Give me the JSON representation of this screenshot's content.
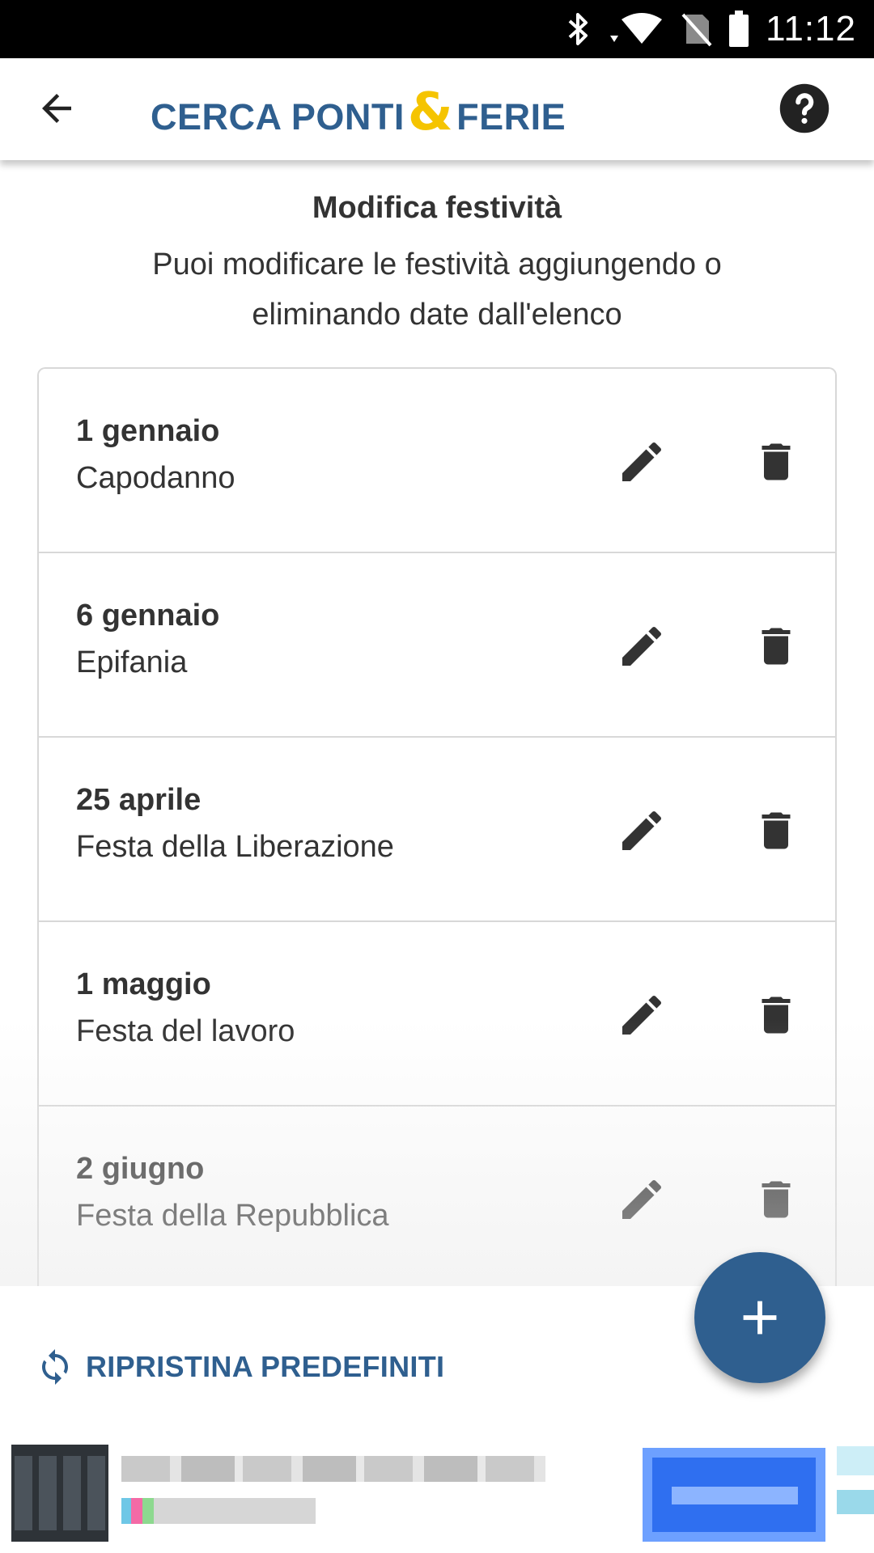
{
  "status_bar": {
    "time": "11:12",
    "icons": [
      "bluetooth-icon",
      "wifi-icon",
      "no-sim-icon",
      "battery-icon"
    ]
  },
  "app_bar": {
    "logo_part1": "CERCA PONTI",
    "logo_amp": "&",
    "logo_part2": "FERIE",
    "brand_color": "#2f5f8f",
    "accent_color": "#f5c400",
    "back_icon": "arrow-back-icon",
    "help_icon": "help-circle-icon"
  },
  "header": {
    "title": "Modifica festività",
    "subtitle": "Puoi modificare le festività aggiungendo o eliminando date dall'elenco"
  },
  "holidays": [
    {
      "date": "1 gennaio",
      "name": "Capodanno"
    },
    {
      "date": "6 gennaio",
      "name": "Epifania"
    },
    {
      "date": "25 aprile",
      "name": "Festa della Liberazione"
    },
    {
      "date": "1 maggio",
      "name": "Festa del lavoro"
    },
    {
      "date": "2 giugno",
      "name": "Festa della Repubblica"
    }
  ],
  "actions": {
    "restore_label": "RIPRISTINA PREDEFINITI",
    "add_icon": "plus-icon",
    "fab_color": "#2f5f8f"
  }
}
